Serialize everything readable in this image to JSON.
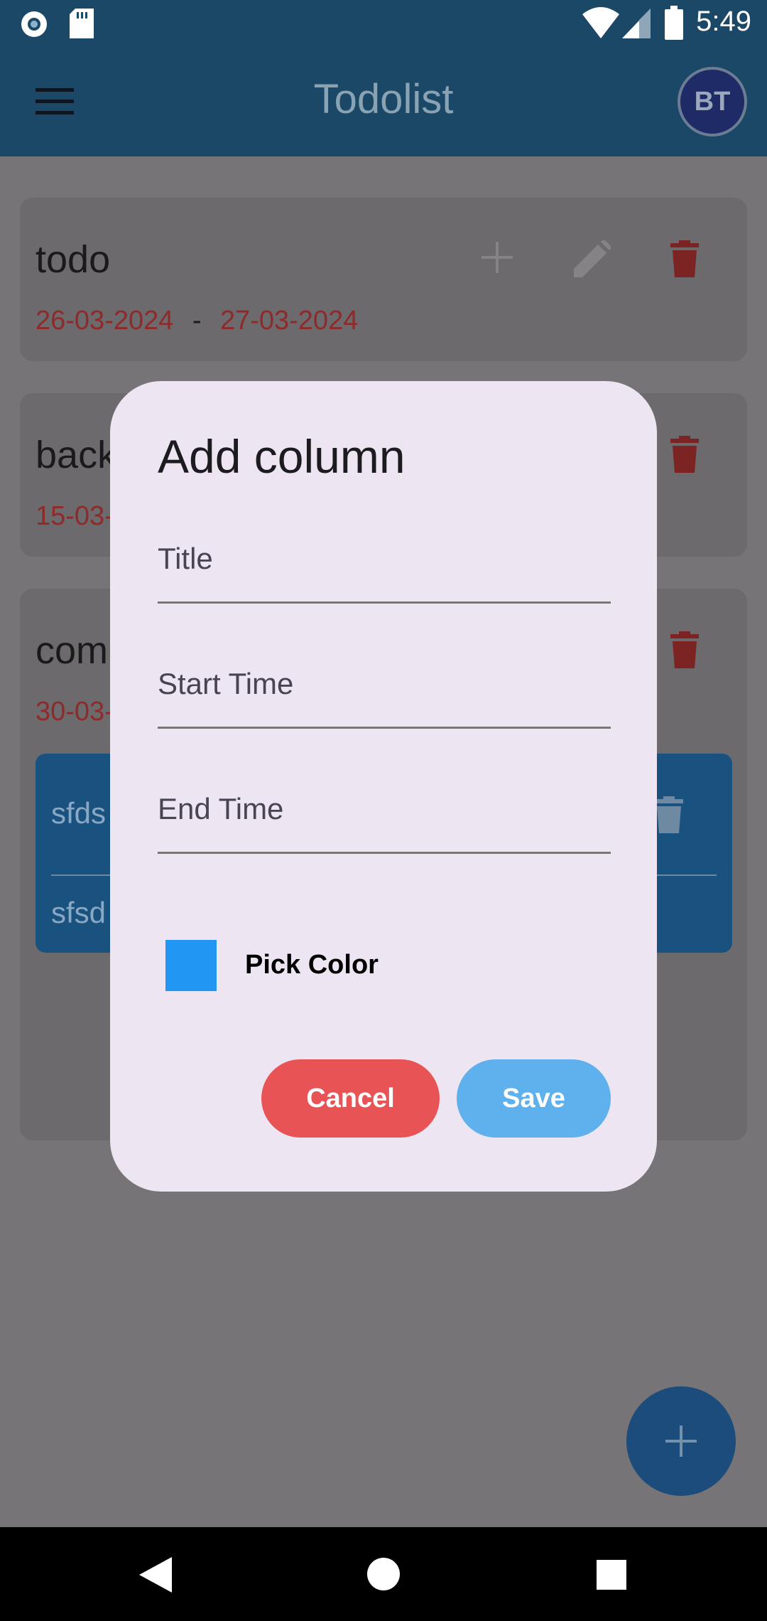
{
  "status": {
    "time": "5:49"
  },
  "appbar": {
    "title": "Todolist",
    "avatar_initials": "BT"
  },
  "columns": [
    {
      "title": "todo",
      "start_date": "26-03-2024",
      "separator": "-",
      "end_date": "27-03-2024"
    },
    {
      "title": "back",
      "start_date": "15-03-"
    },
    {
      "title": "com",
      "start_date": "30-03-"
    }
  ],
  "task": {
    "line1": "sfds",
    "line2": "sfsd"
  },
  "dialog": {
    "title": "Add column",
    "fields": [
      {
        "label": "Title"
      },
      {
        "label": "Start Time"
      },
      {
        "label": "End Time"
      }
    ],
    "pick_color_label": "Pick Color",
    "selected_color": "#2196f3",
    "cancel_label": "Cancel",
    "save_label": "Save"
  },
  "colors": {
    "primary": "#1b4866",
    "cancel": "#e85356",
    "save": "#5fb1ee",
    "dialog_bg": "#ede5f2"
  }
}
